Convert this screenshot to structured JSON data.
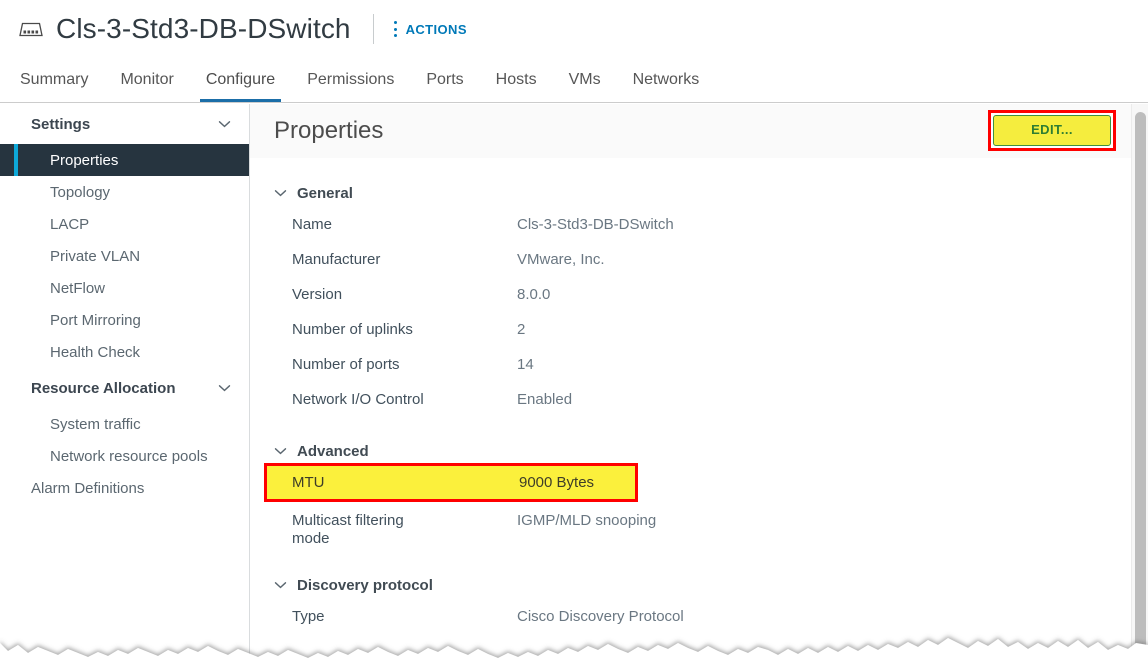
{
  "titlebar": {
    "icon": "distributed-switch-icon",
    "object_name": "Cls-3-Std3-DB-DSwitch",
    "actions_label": "ACTIONS",
    "actions_icon": "kebab-menu-icon"
  },
  "tabs": [
    {
      "label": "Summary",
      "active": false
    },
    {
      "label": "Monitor",
      "active": false
    },
    {
      "label": "Configure",
      "active": true
    },
    {
      "label": "Permissions",
      "active": false
    },
    {
      "label": "Ports",
      "active": false
    },
    {
      "label": "Hosts",
      "active": false
    },
    {
      "label": "VMs",
      "active": false
    },
    {
      "label": "Networks",
      "active": false
    }
  ],
  "sidebar": {
    "groups": [
      {
        "label": "Settings",
        "chevron": "chevron-down-icon",
        "items": [
          {
            "label": "Properties",
            "active": true
          },
          {
            "label": "Topology",
            "active": false
          },
          {
            "label": "LACP",
            "active": false
          },
          {
            "label": "Private VLAN",
            "active": false
          },
          {
            "label": "NetFlow",
            "active": false
          },
          {
            "label": "Port Mirroring",
            "active": false
          },
          {
            "label": "Health Check",
            "active": false
          }
        ]
      },
      {
        "label": "Resource Allocation",
        "chevron": "chevron-down-icon",
        "items": [
          {
            "label": "System traffic",
            "active": false
          },
          {
            "label": "Network resource pools",
            "active": false
          }
        ]
      }
    ],
    "standalone_items": [
      {
        "label": "Alarm Definitions",
        "active": false
      }
    ]
  },
  "content": {
    "title": "Properties",
    "edit_button": {
      "label": "EDIT...",
      "fill_color": "#f5ed3e",
      "border_color": "#3f8f3f",
      "text_color": "#2e7d32",
      "highlight_color": "#ff0000"
    },
    "sections": [
      {
        "title": "General",
        "chevron": "chevron-down-icon",
        "rows": [
          {
            "label": "Name",
            "value": "Cls-3-Std3-DB-DSwitch",
            "highlighted": false
          },
          {
            "label": "Manufacturer",
            "value": "VMware, Inc.",
            "highlighted": false
          },
          {
            "label": "Version",
            "value": "8.0.0",
            "highlighted": false
          },
          {
            "label": "Number of uplinks",
            "value": "2",
            "highlighted": false
          },
          {
            "label": "Number of ports",
            "value": "14",
            "highlighted": false
          },
          {
            "label": "Network I/O Control",
            "value": "Enabled",
            "highlighted": false
          }
        ]
      },
      {
        "title": "Advanced",
        "chevron": "chevron-down-icon",
        "rows": [
          {
            "label": "MTU",
            "value": "9000 Bytes",
            "highlighted": true,
            "highlight_fill": "#fbf03c",
            "highlight_border": "#ff0000"
          },
          {
            "label": "Multicast filtering\nmode",
            "value": "IGMP/MLD snooping",
            "highlighted": false
          }
        ]
      },
      {
        "title": "Discovery protocol",
        "chevron": "chevron-down-icon",
        "rows": [
          {
            "label": "Type",
            "value": "Cisco Discovery Protocol",
            "highlighted": false
          }
        ]
      }
    ]
  },
  "scrollbar": {
    "name": "vertical-scrollbar"
  }
}
